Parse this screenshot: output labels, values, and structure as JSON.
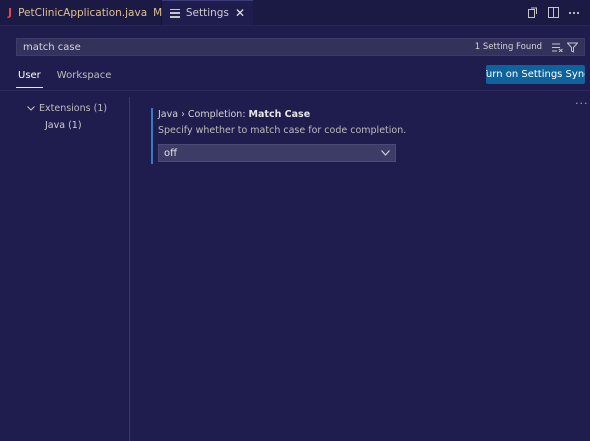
{
  "tabs": [
    {
      "icon": "java-file-icon",
      "glyph": "J",
      "title": "PetClinicApplication.java",
      "modified_indicator": "M",
      "active": false
    },
    {
      "icon": "settings-icon",
      "title": "Settings",
      "close": "✕",
      "active": true
    }
  ],
  "search": {
    "value": "match case",
    "result_count": "1 Setting Found"
  },
  "scope_tabs": [
    "User",
    "Workspace"
  ],
  "sync_button": "Turn on Settings Sync",
  "toc": [
    {
      "label": "Extensions (1)",
      "expanded": true
    },
    {
      "label": "Java (1)",
      "child": true
    }
  ],
  "setting": {
    "category": "Java › Completion: ",
    "name": "Match Case",
    "description": "Specify whether to match case for code completion.",
    "value": "off"
  },
  "colors": {
    "accent": "#0e639c",
    "background": "#1f1d4d",
    "modified": "#e2c08d",
    "java": "#e04848",
    "focus_bar": "#3a78c8"
  }
}
